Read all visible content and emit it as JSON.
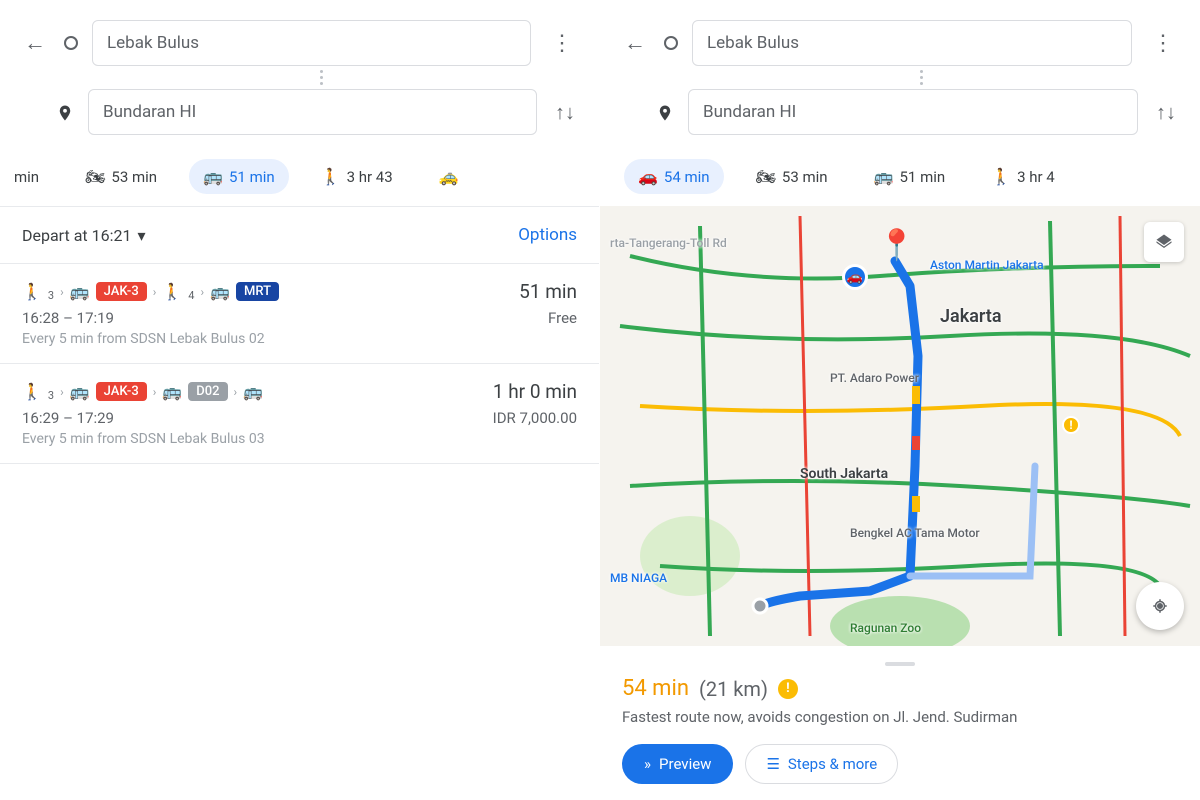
{
  "left": {
    "origin": "Lebak Bulus",
    "destination": "Bundaran HI",
    "modes": {
      "truncated": "min",
      "motorcycle": "53 min",
      "transit": "51 min",
      "walk": "3 hr 43"
    },
    "depart_label": "Depart at 16:21",
    "options_label": "Options",
    "routes": [
      {
        "steps": [
          {
            "type": "walk",
            "sub": "3"
          },
          {
            "type": "bus",
            "badge": "JAK-3",
            "badge_class": "badge-red"
          },
          {
            "type": "walk",
            "sub": "4"
          },
          {
            "type": "bus",
            "badge": "MRT",
            "badge_class": "badge-blue"
          }
        ],
        "duration": "51 min",
        "range": "16:28 – 17:19",
        "price": "Free",
        "note": "Every 5 min from SDSN Lebak Bulus 02"
      },
      {
        "steps": [
          {
            "type": "walk",
            "sub": "3"
          },
          {
            "type": "bus",
            "badge": "JAK-3",
            "badge_class": "badge-red"
          },
          {
            "type": "bus",
            "badge": "D02",
            "badge_class": "badge-grey"
          },
          {
            "type": "bus"
          }
        ],
        "duration": "1 hr 0 min",
        "range": "16:29 – 17:29",
        "price": "IDR 7,000.00",
        "note": "Every 5 min from SDSN Lebak Bulus 03"
      }
    ]
  },
  "right": {
    "origin": "Lebak Bulus",
    "destination": "Bundaran HI",
    "modes": {
      "car": "54 min",
      "motorcycle": "53 min",
      "transit": "51 min",
      "walk": "3 hr 4"
    },
    "map_labels": {
      "jakarta": "Jakarta",
      "south": "South Jakarta",
      "aston": "Aston Martin Jakarta",
      "adaro": "PT. Adaro Power",
      "bengkel": "Bengkel AC Tama Motor",
      "ragunan": "Ragunan Zoo",
      "niaga": "MB NIAGA",
      "toll": "rta-Tangerang-Toll Rd"
    },
    "summary": {
      "time": "54 min",
      "distance": "(21 km)",
      "desc": "Fastest route now, avoids congestion on Jl. Jend. Sudirman",
      "preview": "Preview",
      "steps": "Steps & more"
    }
  }
}
